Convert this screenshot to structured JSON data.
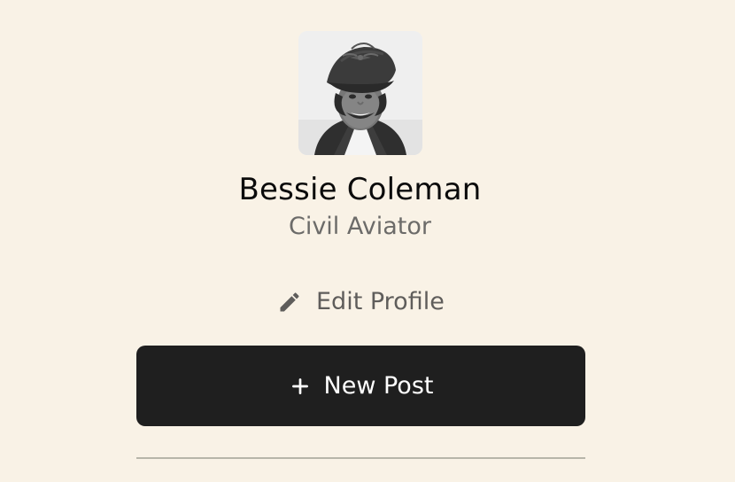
{
  "profile": {
    "name": "Bessie Coleman",
    "title": "Civil Aviator",
    "avatar": {
      "alt": "Portrait photo of Bessie Coleman",
      "style": "black-and-white"
    }
  },
  "actions": {
    "edit_profile_label": "Edit Profile",
    "edit_icon": "pencil-icon",
    "new_post_label": "New Post",
    "new_post_icon": "plus-icon"
  },
  "colors": {
    "background": "#f9f2e6",
    "button_background": "#1f1f1f",
    "button_text": "#ffffff",
    "name_text": "#0b0b0b",
    "subtitle_text": "#6c6b69",
    "divider": "#b8b6aa"
  }
}
